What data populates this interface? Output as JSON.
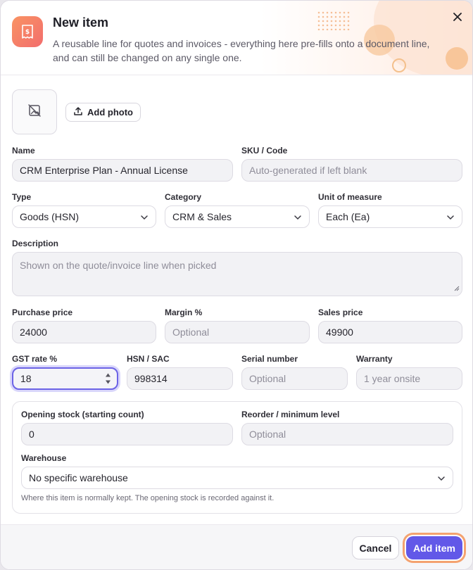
{
  "header": {
    "title": "New item",
    "subtitle": "A reusable line for quotes and invoices - everything here pre-fills onto a document line, and can still be changed on any single one."
  },
  "photo": {
    "add_label": "Add photo"
  },
  "fields": {
    "name": {
      "label": "Name",
      "value": "CRM Enterprise Plan - Annual License"
    },
    "sku": {
      "label": "SKU / Code",
      "placeholder": "Auto-generated if left blank"
    },
    "type": {
      "label": "Type",
      "value": "Goods (HSN)"
    },
    "category": {
      "label": "Category",
      "value": "CRM & Sales"
    },
    "unit": {
      "label": "Unit of measure",
      "value": "Each (Ea)"
    },
    "description": {
      "label": "Description",
      "placeholder": "Shown on the quote/invoice line when picked"
    },
    "purchase_price": {
      "label": "Purchase price",
      "value": "24000"
    },
    "margin": {
      "label": "Margin %",
      "placeholder": "Optional"
    },
    "sales_price": {
      "label": "Sales price",
      "value": "49900"
    },
    "gst_rate": {
      "label": "GST rate %",
      "value": "18"
    },
    "hsn_sac": {
      "label": "HSN / SAC",
      "value": "998314"
    },
    "serial": {
      "label": "Serial number",
      "placeholder": "Optional"
    },
    "warranty": {
      "label": "Warranty",
      "placeholder": "1 year onsite"
    }
  },
  "stock": {
    "opening_label": "Opening stock (starting count)",
    "opening_value": "0",
    "reorder_label": "Reorder / minimum level",
    "reorder_placeholder": "Optional",
    "warehouse_label": "Warehouse",
    "warehouse_value": "No specific warehouse",
    "hint": "Where this item is normally kept. The opening stock is recorded against it."
  },
  "footer": {
    "cancel": "Cancel",
    "add": "Add item"
  },
  "colors": {
    "accent": "#6258e8",
    "brand_gradient_start": "#f99363",
    "brand_gradient_end": "#f26d6d",
    "focus_ring": "#f4a26f"
  },
  "icons": {
    "header": "receipt-icon",
    "close": "close-icon",
    "photo": "image-off-icon",
    "upload": "upload-icon",
    "dropdown": "chevron-down-icon"
  }
}
